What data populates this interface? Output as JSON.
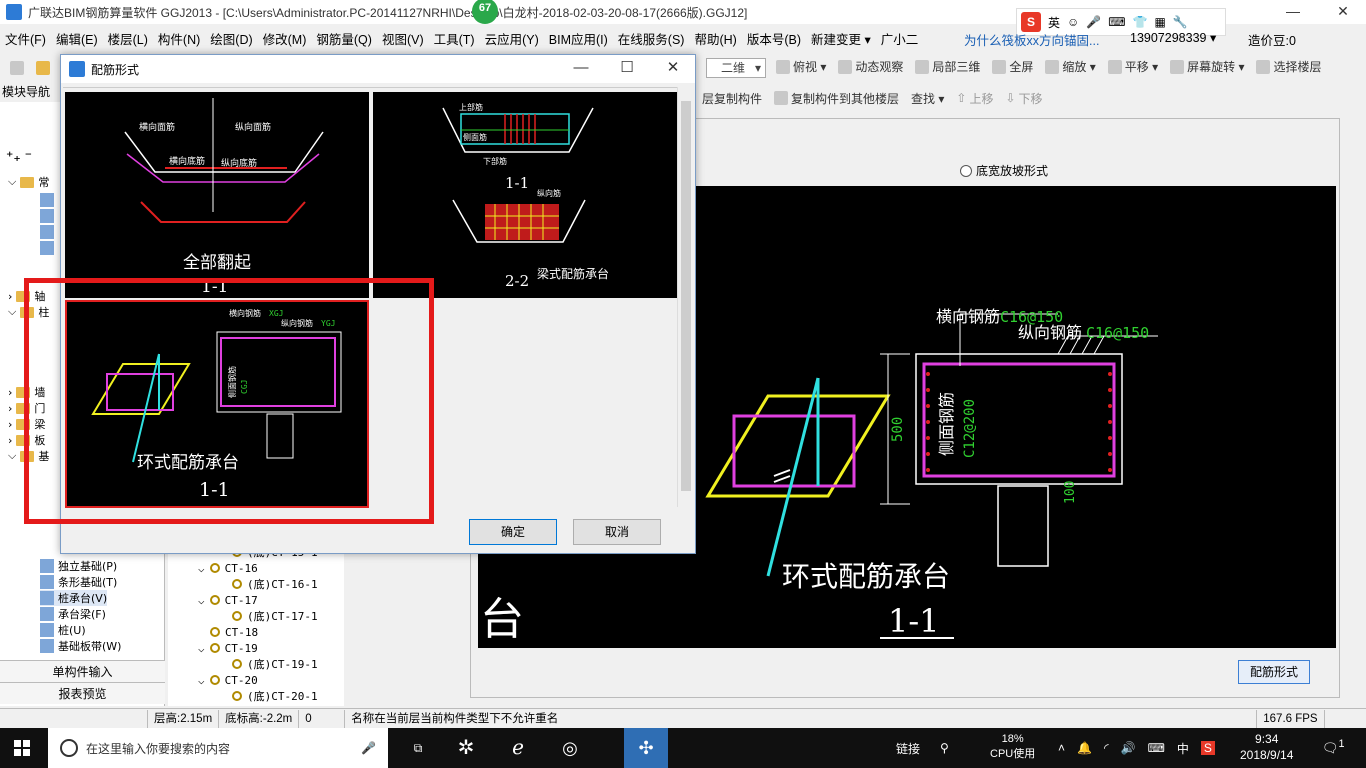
{
  "window": {
    "title": "广联达BIM钢筋算量软件 GGJ2013 - [C:\\Users\\Administrator.PC-20141127NRHI\\Desktop\\白龙村-2018-02-03-20-08-17(2666版).GGJ12]",
    "badge": "67",
    "minimize": "—",
    "restore": "❐",
    "close": "✕"
  },
  "ime": {
    "s": "S",
    "lang": "英"
  },
  "menu": {
    "items": [
      "文件(F)",
      "编辑(E)",
      "楼层(L)",
      "构件(N)",
      "绘图(D)",
      "修改(M)",
      "钢筋量(Q)",
      "视图(V)",
      "工具(T)",
      "云应用(Y)",
      "BIM应用(I)",
      "在线服务(S)",
      "帮助(H)",
      "版本号(B)",
      "新建变更 ▾",
      "广小二"
    ],
    "promo": "为什么筏板xx方向锚固...",
    "phone": "13907298339 ▾",
    "bean": "造价豆:0"
  },
  "toolbar1": {
    "view2d": "二维",
    "items": [
      "俯视 ▾",
      "动态观察",
      "局部三维",
      "全屏",
      "缩放 ▾",
      "平移 ▾",
      "屏幕旋转 ▾",
      "选择楼层"
    ]
  },
  "toolbar2": {
    "items": [
      "层复制构件",
      "复制构件到其他楼层",
      "查找 ▾",
      "上移",
      "下移"
    ]
  },
  "nav": {
    "header": "模块导航栏",
    "tree": [
      "常",
      "轴",
      "柱",
      "墙",
      "门",
      "梁",
      "板",
      "基"
    ],
    "items": [
      "独立基础(P)",
      "条形基础(T)",
      "桩承台(V)",
      "承台梁(F)",
      "桩(U)",
      "基础板带(W)"
    ],
    "btn_single": "单构件输入",
    "btn_report": "报表预览"
  },
  "midlist": {
    "rows": [
      {
        "label": "(底)CT-15-1",
        "indent": 2
      },
      {
        "label": "CT-16",
        "indent": 1
      },
      {
        "label": "(底)CT-16-1",
        "indent": 2
      },
      {
        "label": "CT-17",
        "indent": 1
      },
      {
        "label": "(底)CT-17-1",
        "indent": 2
      },
      {
        "label": "CT-18",
        "indent": 1
      },
      {
        "label": "CT-19",
        "indent": 1
      },
      {
        "label": "(底)CT-19-1",
        "indent": 2
      },
      {
        "label": "CT-20",
        "indent": 1
      },
      {
        "label": "(底)CT-20-1",
        "indent": 2
      }
    ]
  },
  "rightpanel": {
    "radio_label": "底宽放坡形式",
    "cad": {
      "transverse": "横向钢筋",
      "transverse_spec": "C16@150",
      "longitudinal": "纵向钢筋",
      "longitudinal_spec": "C16@150",
      "side": "侧面钢筋",
      "side_spec": "C12@200",
      "dim500": "500",
      "dim100": "100",
      "caption": "环式配筋承台",
      "section": "1-1",
      "left_fragment": "台"
    },
    "btn_rebar": "配筋形式"
  },
  "dialog": {
    "title": "配筋形式",
    "thumbs": [
      {
        "caption": "全部翻起",
        "section": "1-1",
        "labels": [
          "横向面筋",
          "纵向面筋",
          "横向底筋",
          "纵向底筋"
        ]
      },
      {
        "caption": "梁式配筋承台",
        "section1": "1-1",
        "section2": "2-2",
        "labels": [
          "上部筋",
          "侧面筋",
          "下部筋",
          "纵向筋"
        ]
      },
      {
        "caption": "环式配筋承台",
        "section": "1-1",
        "labels": [
          "横向钢筋",
          "纵向钢筋",
          "侧面钢筋"
        ],
        "codes": [
          "XGJ",
          "YGJ",
          "CGJ"
        ]
      }
    ],
    "ok": "确定",
    "cancel": "取消"
  },
  "status": {
    "floor_height": "层高:2.15m",
    "bottom_height": "底标高:-2.2m",
    "zero": "0",
    "message": "名称在当前层当前构件类型下不允许重名",
    "fps": "167.6 FPS"
  },
  "taskbar": {
    "search_placeholder": "在这里输入你要搜索的内容",
    "tray_link": "链接",
    "cpu_pct": "18%",
    "cpu_label": "CPU使用",
    "lang": "中",
    "time": "9:34",
    "date": "2018/9/14",
    "notifications": "1"
  },
  "colors": {
    "highlight_red": "#e41a1a",
    "cad_magenta": "#e040e0",
    "cad_yellow": "#f0f020",
    "cad_cyan": "#30e0e0",
    "cad_green": "#30d030",
    "cad_red": "#e02020"
  }
}
